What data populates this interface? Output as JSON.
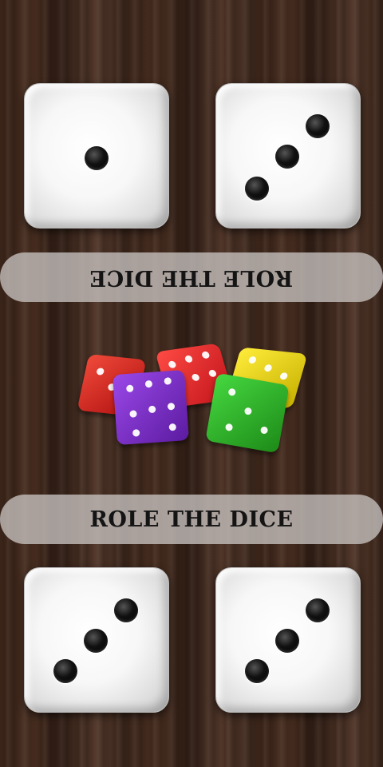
{
  "game": {
    "top_player": {
      "roll_button_label": "ROLE THE DICE",
      "dice": [
        {
          "value": 1
        },
        {
          "value": 3
        }
      ]
    },
    "bottom_player": {
      "roll_button_label": "ROLE THE DICE",
      "dice": [
        {
          "value": 3
        },
        {
          "value": 3
        }
      ]
    }
  },
  "decoration": {
    "center_image": "colorful-dice-cluster",
    "dice_colors": [
      "#d61f1f",
      "#8a2ad0",
      "#e8201c",
      "#e6d21e",
      "#33b42c"
    ],
    "board_style": "dark-wood"
  }
}
